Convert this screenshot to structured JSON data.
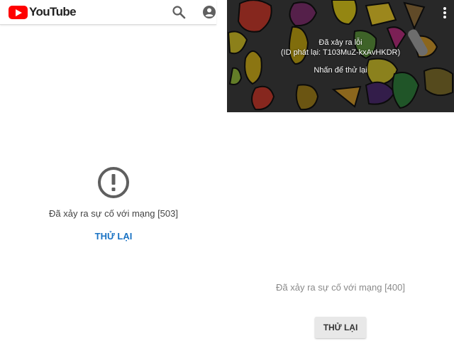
{
  "left": {
    "header": {
      "logo_text": "YouTube",
      "search_icon": "search-icon",
      "account_icon": "account-circle-icon"
    },
    "error": {
      "icon": "exclamation-circle-icon",
      "message": "Đã xảy ra sự cố với mạng [503]",
      "retry_label": "THỬ LẠI"
    }
  },
  "right": {
    "player": {
      "error_title": "Đã xảy ra lỗi",
      "playback_id": "(ID phát lại: T103MuZ-kxAvHKDR)",
      "tap_to_retry": "Nhấn để thử lại",
      "menu_icon": "more-vert-icon"
    },
    "error": {
      "message": "Đã xảy ra sự cố với mạng [400]",
      "retry_label": "THỬ LẠI"
    }
  },
  "colors": {
    "brand_red": "#ff0000",
    "link_blue": "#1a73c4",
    "icon_gray": "#5f5f5f"
  }
}
